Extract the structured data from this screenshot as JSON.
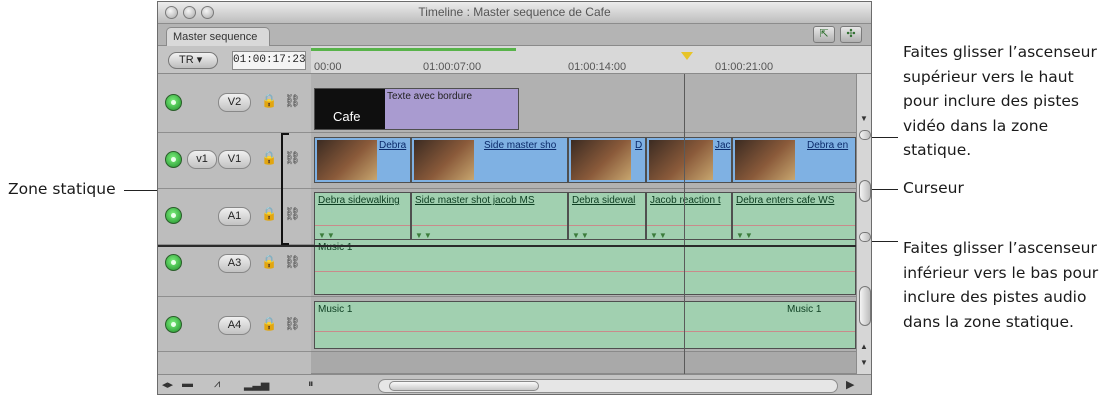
{
  "window": {
    "title": "Timeline : Master sequence de Cafe",
    "tab": "Master sequence"
  },
  "controls": {
    "tr_label": "TR ▾",
    "timecode": "01:00:17:23"
  },
  "ruler": {
    "labels": [
      "00:00",
      "01:00:07:00",
      "01:00:14:00",
      "01:00:21:00"
    ]
  },
  "tracks": {
    "v2": {
      "dest": "V2"
    },
    "v1": {
      "source": "v1",
      "dest": "V1"
    },
    "a1": {
      "dest": "A1"
    },
    "a3": {
      "dest": "A3"
    },
    "a4": {
      "dest": "A4"
    }
  },
  "icons": {
    "lock": "🔒",
    "link": "⛓",
    "vis": "visibility-icon"
  },
  "clips": {
    "gen_title": "Texte avec bordure",
    "gen_label": "Cafe",
    "v1": [
      "Debra",
      "Side master sho",
      "D",
      "Jac",
      "Debra en"
    ],
    "a1": [
      "Debra sidewalking",
      "Side master shot jacob MS",
      "Debra sidewal",
      "Jacob reaction t",
      "Debra enters cafe WS"
    ],
    "a3": "Music 1",
    "a4_left": "Music 1",
    "a4_right": "Music 1"
  },
  "callouts": {
    "top": [
      "Faites glisser l’ascenseur",
      "supérieur vers le haut",
      "pour inclure des pistes",
      "vidéo dans la zone",
      "statique."
    ],
    "curseur": "Curseur",
    "bottom": [
      "Faites glisser l’ascenseur",
      "inférieur vers le bas pour",
      "inclure des pistes audio",
      "dans la zone statique."
    ],
    "zone": "Zone statique"
  },
  "colors": {
    "video_clip": "#7fb1e3",
    "audio_clip": "#a1d0b0",
    "generator_clip": "#a99bd0",
    "ruler_green": "#58b34a",
    "playhead_yellow": "#e7c428"
  }
}
